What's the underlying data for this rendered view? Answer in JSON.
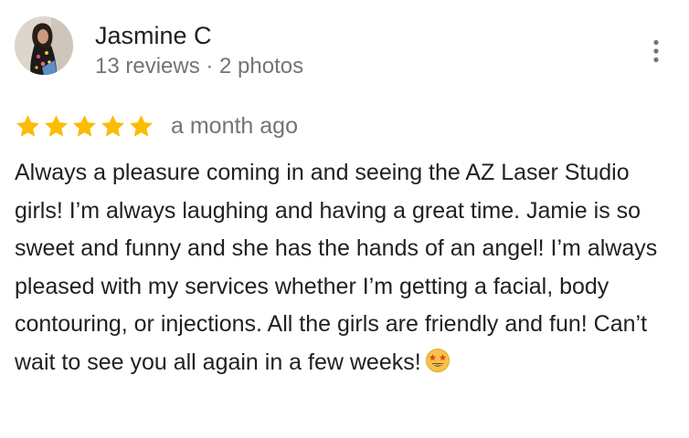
{
  "reviewer": {
    "name": "Jasmine C",
    "meta": "13 reviews · 2 photos"
  },
  "review": {
    "rating": 5,
    "rating_max": 5,
    "date": "a month ago",
    "text": "Always a pleasure coming in and seeing the AZ Laser Studio girls! I’m always laughing and having a great time. Jamie is so sweet and funny and she has the hands of an angel! I’m always pleased with my services whether I’m getting a facial, body contouring, or injections. All the girls are friendly and fun! Can’t wait to see you all again in a few weeks!",
    "trailing_emoji": "star-struck-emoji"
  },
  "icons": {
    "more": "more-vert-icon",
    "star": "star-icon"
  },
  "colors": {
    "star": "#fbbc04",
    "name": "#202124",
    "secondary_text": "#70757a",
    "body_text": "#202124"
  }
}
